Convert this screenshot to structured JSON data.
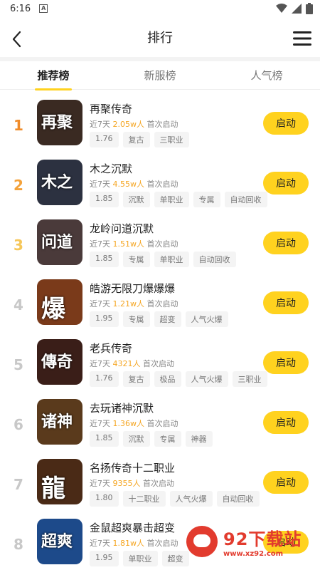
{
  "status_bar": {
    "time": "6:16",
    "notification_icon": "A"
  },
  "nav": {
    "title": "排行",
    "back_icon": "chevron-left-icon",
    "menu_icon": "hamburger-menu-icon"
  },
  "tabs": [
    {
      "label": "推荐榜",
      "active": true
    },
    {
      "label": "新服榜",
      "active": false
    },
    {
      "label": "人气榜",
      "active": false
    }
  ],
  "games": [
    {
      "rank": "1",
      "name": "再聚传奇",
      "period": "近7天",
      "count": "2.05w人",
      "suffix": "首次启动",
      "tags": [
        "1.76",
        "复古",
        "三职业"
      ],
      "button": "启动",
      "icon_text": "再聚",
      "icon_bg": "#3a2a22"
    },
    {
      "rank": "2",
      "name": "木之沉默",
      "period": "近7天",
      "count": "4.55w人",
      "suffix": "首次启动",
      "tags": [
        "1.85",
        "沉默",
        "单职业",
        "专属",
        "自动回收"
      ],
      "button": "启动",
      "icon_text": "木之",
      "icon_bg": "#2c3140"
    },
    {
      "rank": "3",
      "name": "龙岭问道沉默",
      "period": "近7天",
      "count": "1.51w人",
      "suffix": "首次启动",
      "tags": [
        "1.85",
        "专属",
        "单职业",
        "自动回收"
      ],
      "button": "启动",
      "icon_text": "问道",
      "icon_bg": "#4a3a3a"
    },
    {
      "rank": "4",
      "name": "皓游无限刀爆爆爆",
      "period": "近7天",
      "count": "1.21w人",
      "suffix": "首次启动",
      "tags": [
        "1.95",
        "专属",
        "超变",
        "人气火爆"
      ],
      "button": "启动",
      "icon_text": "爆",
      "icon_bg": "#7a3a1a"
    },
    {
      "rank": "5",
      "name": "老兵传奇",
      "period": "近7天",
      "count": "4321人",
      "suffix": "首次启动",
      "tags": [
        "1.76",
        "复古",
        "极品",
        "人气火爆",
        "三职业"
      ],
      "button": "启动",
      "icon_text": "傳奇",
      "icon_bg": "#3a1e18"
    },
    {
      "rank": "6",
      "name": "去玩诸神沉默",
      "period": "近7天",
      "count": "1.36w人",
      "suffix": "首次启动",
      "tags": [
        "1.85",
        "沉默",
        "专属",
        "神器"
      ],
      "button": "启动",
      "icon_text": "诸神",
      "icon_bg": "#5a3a1c"
    },
    {
      "rank": "7",
      "name": "名扬传奇十二职业",
      "period": "近7天",
      "count": "9355人",
      "suffix": "首次启动",
      "tags": [
        "1.80",
        "十二职业",
        "人气火爆",
        "自动回收"
      ],
      "button": "启动",
      "icon_text": "龍",
      "icon_bg": "#4a2a16"
    },
    {
      "rank": "8",
      "name": "金鼠超爽暴击超变",
      "period": "近7天",
      "count": "1.81w人",
      "suffix": "首次启动",
      "tags": [
        "1.95",
        "单职业",
        "超变"
      ],
      "button": "启动",
      "icon_text": "超爽",
      "icon_bg": "#1d4a8a"
    }
  ],
  "watermark": {
    "title": "92下载站",
    "url": "www.xz92.com"
  },
  "colors": {
    "accent": "#ffd21f",
    "count": "#f5a623",
    "rank1": "#f08c2a",
    "rank2": "#f4a23a",
    "rank3": "#f6c75a",
    "watermark": "#e23b2e"
  }
}
